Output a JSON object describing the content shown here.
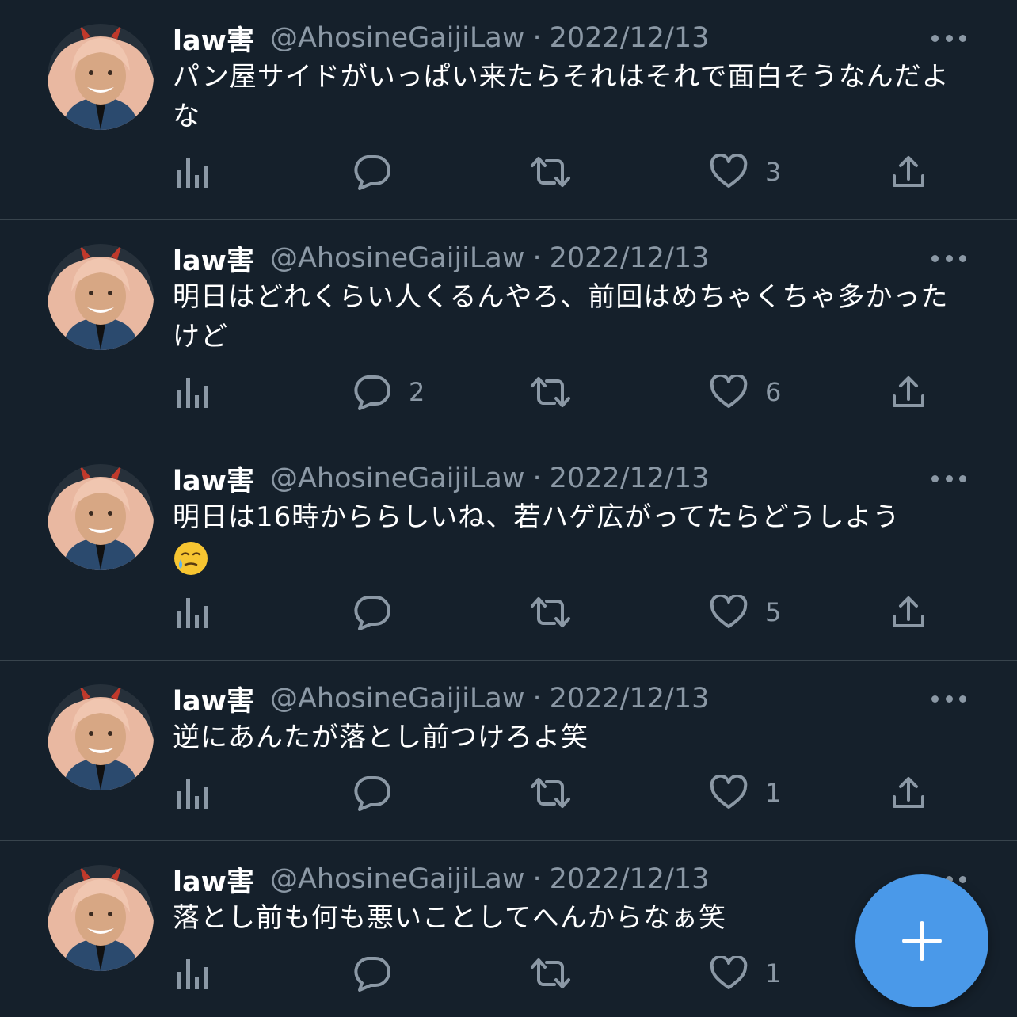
{
  "tweets": [
    {
      "name": "law害",
      "handle": "@AhosineGaijiLaw",
      "separator": "·",
      "date": "2022/12/13",
      "text": "パン屋サイドがいっぱい来たらそれはそれで面白そうなんだよな",
      "replies": "",
      "likes": "3"
    },
    {
      "name": "law害",
      "handle": "@AhosineGaijiLaw",
      "separator": "·",
      "date": "2022/12/13",
      "text": "明日はどれくらい人くるんやろ、前回はめちゃくちゃ多かったけど",
      "replies": "2",
      "likes": "6"
    },
    {
      "name": "law害",
      "handle": "@AhosineGaijiLaw",
      "separator": "·",
      "date": "2022/12/13",
      "text": "明日は16時かららしいね、若ハゲ広がってたらどうしよう",
      "emoji": "face-holding-back-tears",
      "replies": "",
      "likes": "5"
    },
    {
      "name": "law害",
      "handle": "@AhosineGaijiLaw",
      "separator": "·",
      "date": "2022/12/13",
      "text": "逆にあんたが落とし前つけろよ笑",
      "replies": "",
      "likes": "1"
    },
    {
      "name": "law害",
      "handle": "@AhosineGaijiLaw",
      "separator": "·",
      "date": "2022/12/13",
      "text": "落とし前も何も悪いことしてへんからなぁ笑",
      "replies": "",
      "likes": "1"
    }
  ],
  "icons": {
    "views": "views-bar-chart-icon",
    "reply": "reply-bubble-icon",
    "retweet": "retweet-icon",
    "like": "heart-icon",
    "share": "share-upload-icon",
    "more": "more-dots-icon",
    "compose": "plus-icon"
  },
  "colors": {
    "background": "#15202b",
    "divider": "#38444d",
    "secondary_text": "#8b98a5",
    "primary_text": "#ffffff",
    "accent": "#4a99e9"
  }
}
